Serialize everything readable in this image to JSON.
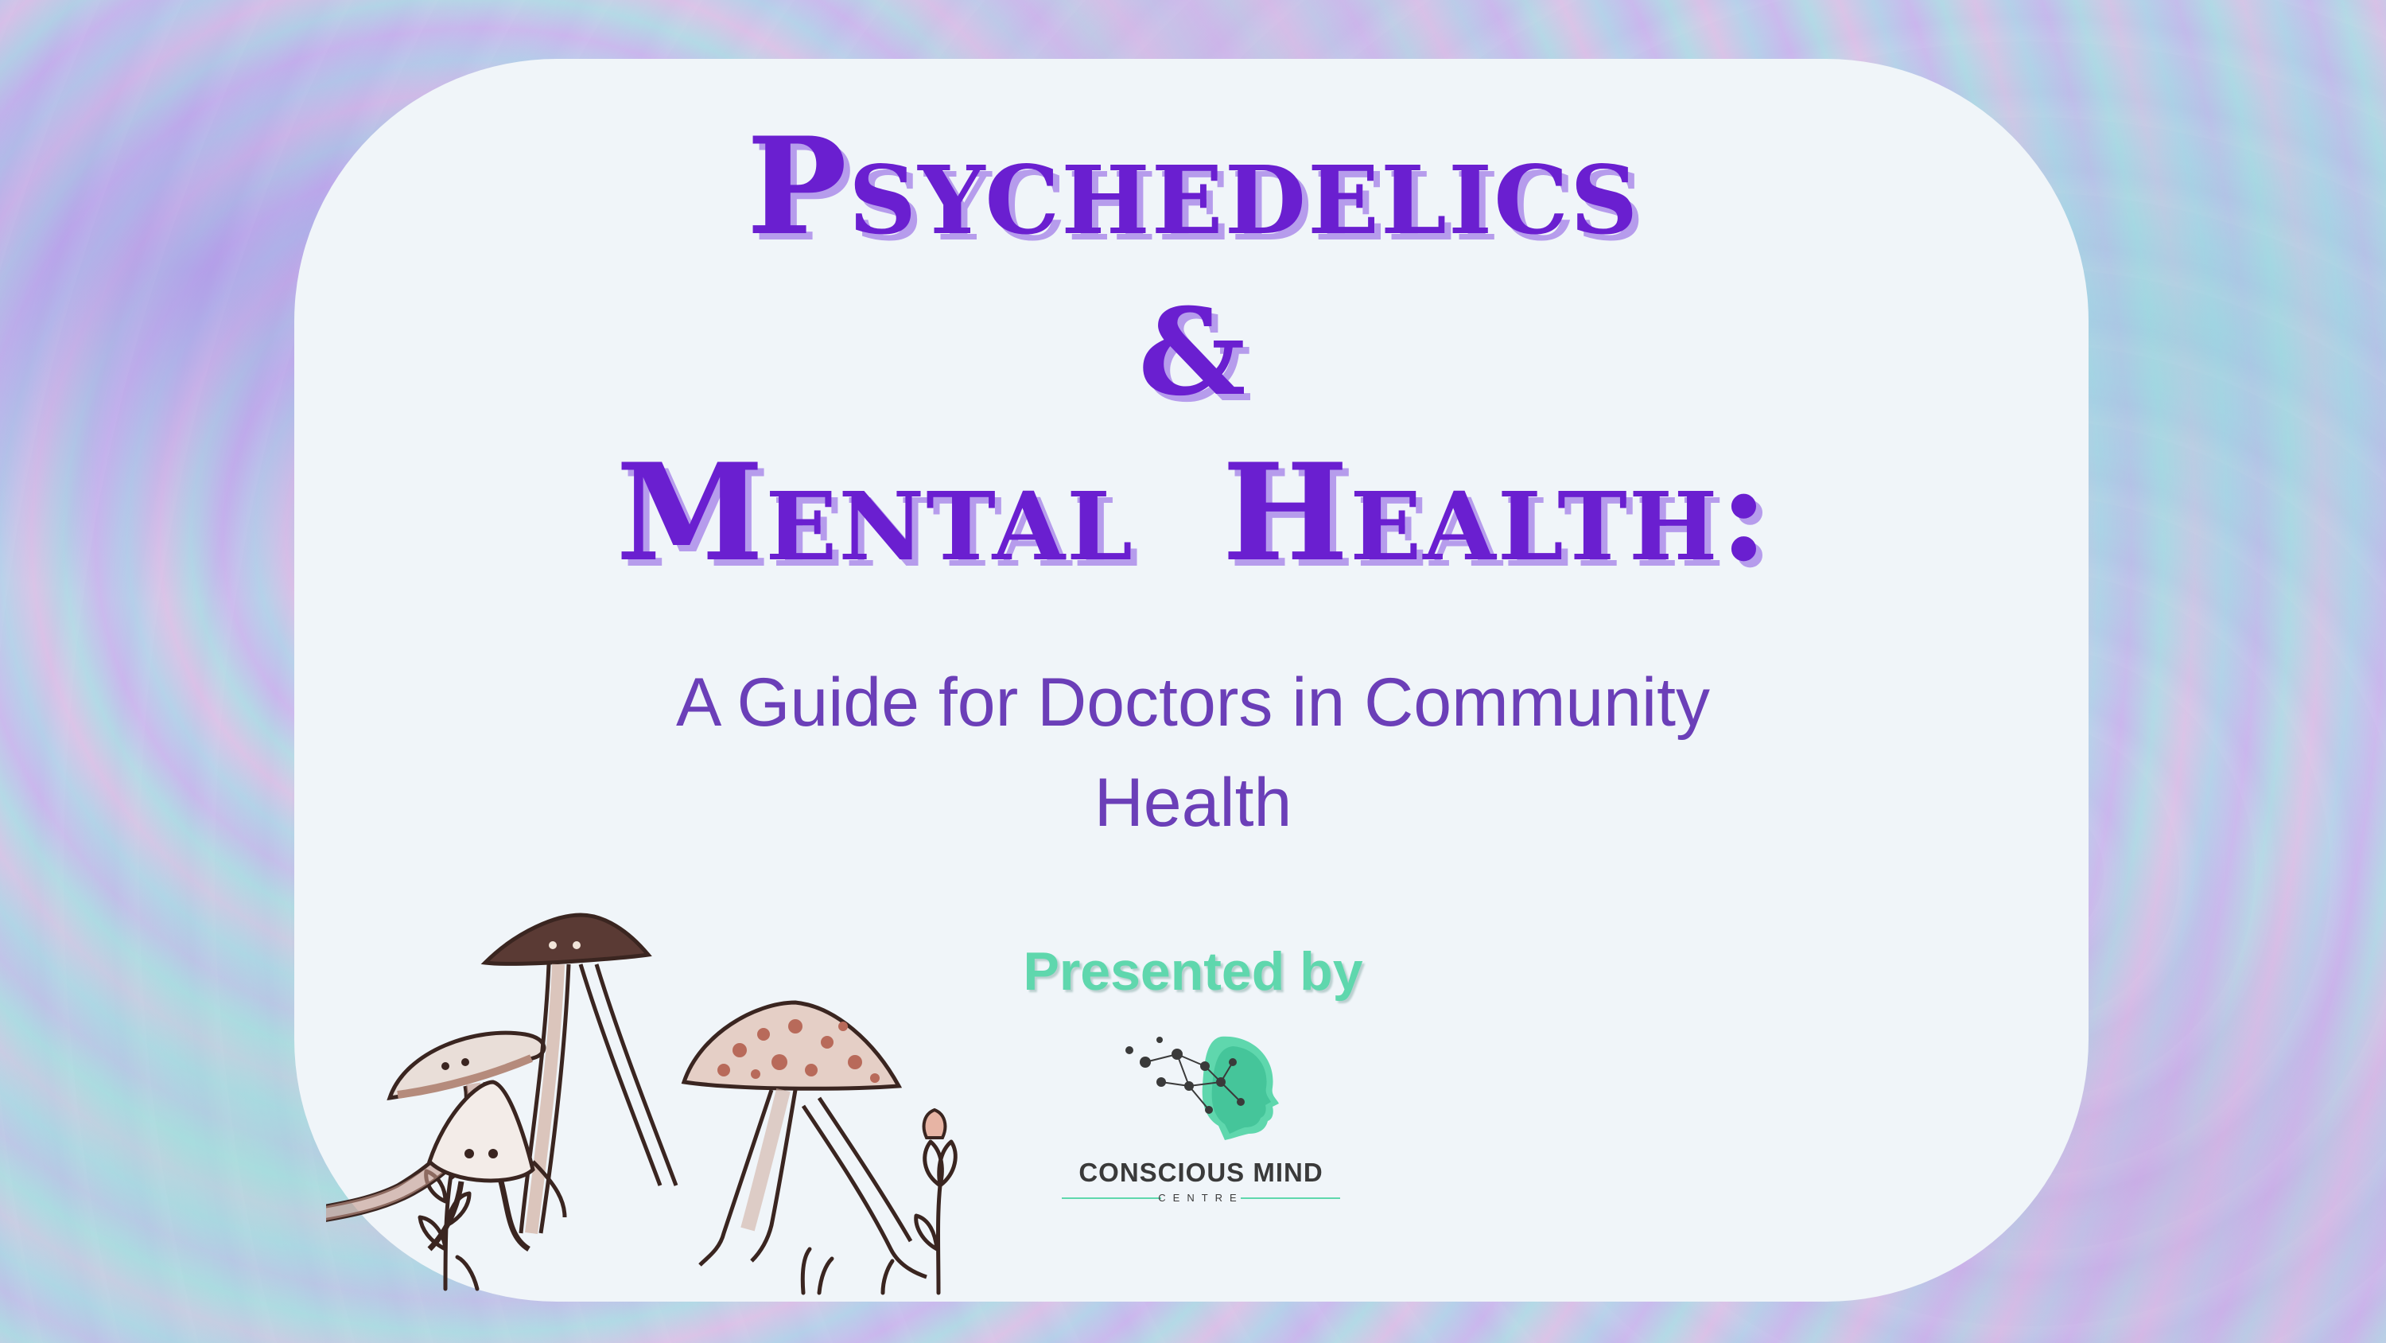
{
  "slide": {
    "title_line1": "Psychedelics",
    "title_line2": "&",
    "title_line3": "Mental Health:",
    "subtitle_line1": "A Guide for Doctors in Community",
    "subtitle_line2": "Health",
    "presented_by": "Presented by"
  },
  "logo": {
    "name": "CONSCIOUS MIND",
    "sub": "CENTRE",
    "icon": "head-neural-network-icon"
  },
  "illustration": {
    "icon": "walking-mushrooms-illustration"
  },
  "colors": {
    "title": "#6a1fd0",
    "title_shadow": "#b69cec",
    "subtitle": "#6b3fb8",
    "presented_by": "#5fd7ad",
    "card": "#f0f5f9"
  }
}
